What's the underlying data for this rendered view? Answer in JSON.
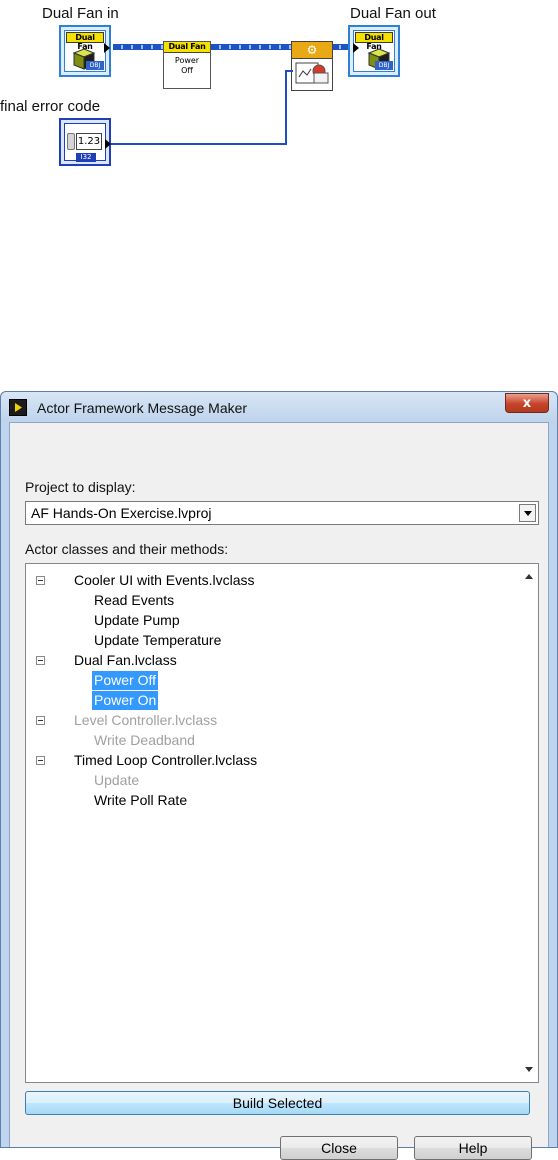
{
  "diagram": {
    "labels": {
      "dual_fan_in": "Dual Fan in",
      "dual_fan_out": "Dual Fan out",
      "final_error_code": "final error code"
    },
    "terminal_header": "Dual Fan",
    "terminal_badge": "DBJ",
    "node": {
      "header": "Dual Fan",
      "body_line1": "Power",
      "body_line2": "Off"
    },
    "numeric_control": {
      "value": "1.23",
      "type": "I32"
    }
  },
  "dialog": {
    "title": "Actor Framework Message Maker",
    "close_glyph": "x",
    "project_label": "Project to display:",
    "project_value": "AF Hands-On Exercise.lvproj",
    "tree_label": "Actor classes and their methods:",
    "classes": [
      {
        "name": "Cooler UI with Events.lvclass",
        "disabled": false,
        "methods": [
          {
            "name": "Read Events",
            "selected": false,
            "disabled": false
          },
          {
            "name": "Update Pump",
            "selected": false,
            "disabled": false
          },
          {
            "name": "Update Temperature",
            "selected": false,
            "disabled": false
          }
        ]
      },
      {
        "name": "Dual Fan.lvclass",
        "disabled": false,
        "methods": [
          {
            "name": "Power Off",
            "selected": true,
            "disabled": false
          },
          {
            "name": "Power On",
            "selected": true,
            "disabled": false
          }
        ]
      },
      {
        "name": "Level Controller.lvclass",
        "disabled": true,
        "methods": [
          {
            "name": "Write Deadband",
            "selected": false,
            "disabled": true
          }
        ]
      },
      {
        "name": "Timed Loop Controller.lvclass",
        "disabled": false,
        "methods": [
          {
            "name": "Update",
            "selected": false,
            "disabled": true
          },
          {
            "name": "Write Poll Rate",
            "selected": false,
            "disabled": false
          }
        ]
      }
    ],
    "buttons": {
      "build": "Build Selected",
      "close": "Close",
      "help": "Help"
    }
  }
}
